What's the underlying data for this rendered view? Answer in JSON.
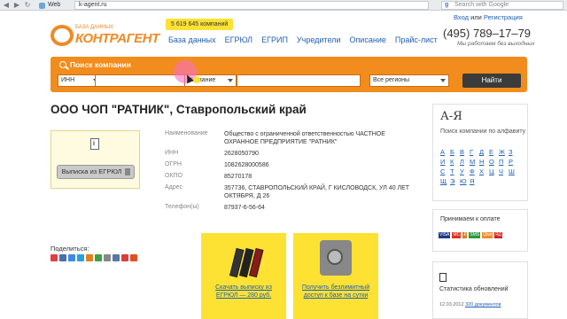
{
  "browser": {
    "tab_label": "Web",
    "url": "k-agent.ru",
    "search_placeholder": "Search with Google"
  },
  "header": {
    "logo_tagline": "БАЗА ДАННЫХ",
    "logo_name": "КОНТРАГЕНТ",
    "companies_count": "5 619 645 компаний",
    "nav": [
      "База данных",
      "ЕГРЮЛ",
      "ЕГРИП",
      "Учредители",
      "Описание",
      "Прайс-лист"
    ],
    "login": "Вход",
    "auth_sep": "или",
    "register": "Регистрация",
    "phone": "(495) 789–17–79",
    "hours": "Мы работаем без выходных"
  },
  "search": {
    "title": "Поиск компании",
    "field1_selected": "ИНН",
    "field2_selected": "Название",
    "region_selected": "Все регионы",
    "button": "Найти"
  },
  "company": {
    "title": "ООО ЧОП \"РАТНИК\", Ставропольский край",
    "extract_button": "Выписка из ЕГРЮЛ",
    "fields": [
      {
        "label": "Наименование",
        "value": "Общество с ограниченной ответственностью ЧАСТНОЕ ОХРАННОЕ ПРЕДПРИЯТИЕ \"РАТНИК\""
      },
      {
        "label": "ИНН",
        "value": "2628050790"
      },
      {
        "label": "ОГРН",
        "value": "1082628000586"
      },
      {
        "label": "ОКПО",
        "value": "85270178"
      },
      {
        "label": "Адрес",
        "value": "357736, СТАВРОПОЛЬСКИЙ КРАЙ, Г КИСЛОВОДСК, УЛ 40 ЛЕТ ОКТЯБРЯ, Д 26"
      },
      {
        "label": "Телефон(ы)",
        "value": "87937-6-56-64"
      }
    ]
  },
  "share": {
    "label": "Поделиться:",
    "icon_colors": [
      "#e04040",
      "#4a6ea8",
      "#3b8be0",
      "#2aa0e0",
      "#e08020",
      "#3fa040",
      "#888888",
      "#5577aa",
      "#d84040",
      "#e05020"
    ]
  },
  "cta": {
    "download": "Скачать выписку из ЕГРЮЛ — 280 руб.",
    "unlimited": "Получить безлимитный доступ к базе на сутки"
  },
  "sidebar": {
    "az_title": "А-Я",
    "az_subtitle": "Поиск компании по алфавиту",
    "letters": [
      "А",
      "Б",
      "В",
      "Г",
      "Д",
      "Е",
      "Ж",
      "З",
      "И",
      "К",
      "Л",
      "М",
      "Н",
      "О",
      "П",
      "Р",
      "С",
      "Т",
      "У",
      "Ф",
      "Х",
      "Ц",
      "Ч",
      "Ш",
      "Щ",
      "Э",
      "Ю",
      "Я"
    ],
    "payment_label": "Принимаем к оплате",
    "payment_methods": [
      "VISA",
      "MC",
      "₽",
      "SMS",
      "Qiwi",
      "ЯД"
    ],
    "stats_label": "Статистика обновлений",
    "stats_date": "12.03.2012",
    "stats_docs": "320 документов"
  },
  "colors": {
    "brand_orange": "#f28c1c",
    "accent_yellow": "#fde233",
    "link_blue": "#1f5fb8"
  }
}
